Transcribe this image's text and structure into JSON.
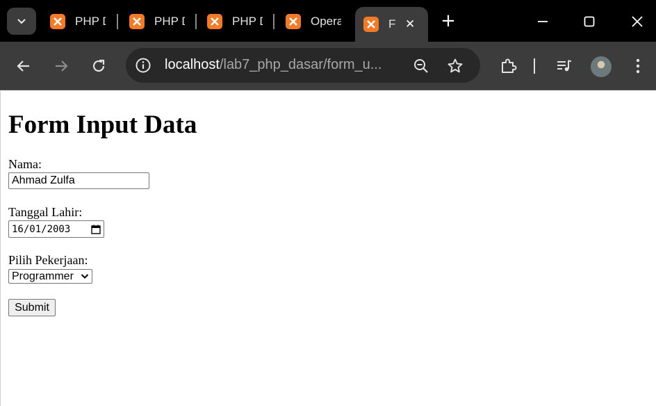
{
  "browser": {
    "tabs": [
      {
        "title": "PHP Dasar",
        "active": false
      },
      {
        "title": "PHP Dasar",
        "active": false
      },
      {
        "title": "PHP Dasar",
        "active": false
      },
      {
        "title": "Operator",
        "active": false
      },
      {
        "title": "Form",
        "active": true
      }
    ],
    "url_host": "localhost",
    "url_path": "/lab7_php_dasar/form_u...",
    "accent": "#f47a25"
  },
  "page": {
    "heading": "Form Input Data",
    "nama_label": "Nama:",
    "nama_value": "Ahmad Zulfa",
    "tanggal_label": "Tanggal Lahir:",
    "tanggal_value": "16/01/2003",
    "pekerjaan_label": "Pilih Pekerjaan:",
    "pekerjaan_value": "Programmer",
    "submit_label": "Submit"
  }
}
